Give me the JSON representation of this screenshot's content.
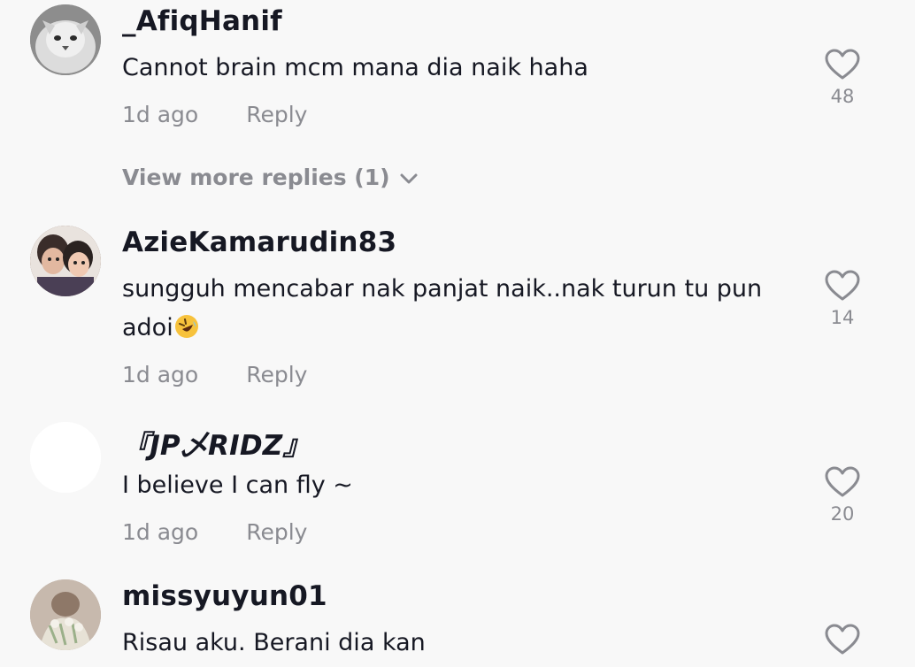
{
  "comments": [
    {
      "username": "_AfiqHanif",
      "text": "Cannot brain mcm mana dia naik haha",
      "time": "1d ago",
      "reply_label": "Reply",
      "likes": "48",
      "more_replies": "View more replies (1)"
    },
    {
      "username": "AzieKamarudin83",
      "text": "sungguh mencabar nak panjat naik..nak turun tu pun adoi",
      "emoji": "🤣",
      "time": "1d ago",
      "reply_label": "Reply",
      "likes": "14"
    },
    {
      "username": "『JP乄RIDZ』",
      "text": "I believe I can fly ~",
      "time": "1d ago",
      "reply_label": "Reply",
      "likes": "20"
    },
    {
      "username": "missyuyun01",
      "text": "Risau aku. Berani dia kan"
    }
  ],
  "colors": {
    "background": "#f8f8f8",
    "primary_text": "#161823",
    "secondary_text": "#8a8b91"
  },
  "icons": {
    "like": "heart-outline-icon",
    "expand": "chevron-down-icon"
  }
}
